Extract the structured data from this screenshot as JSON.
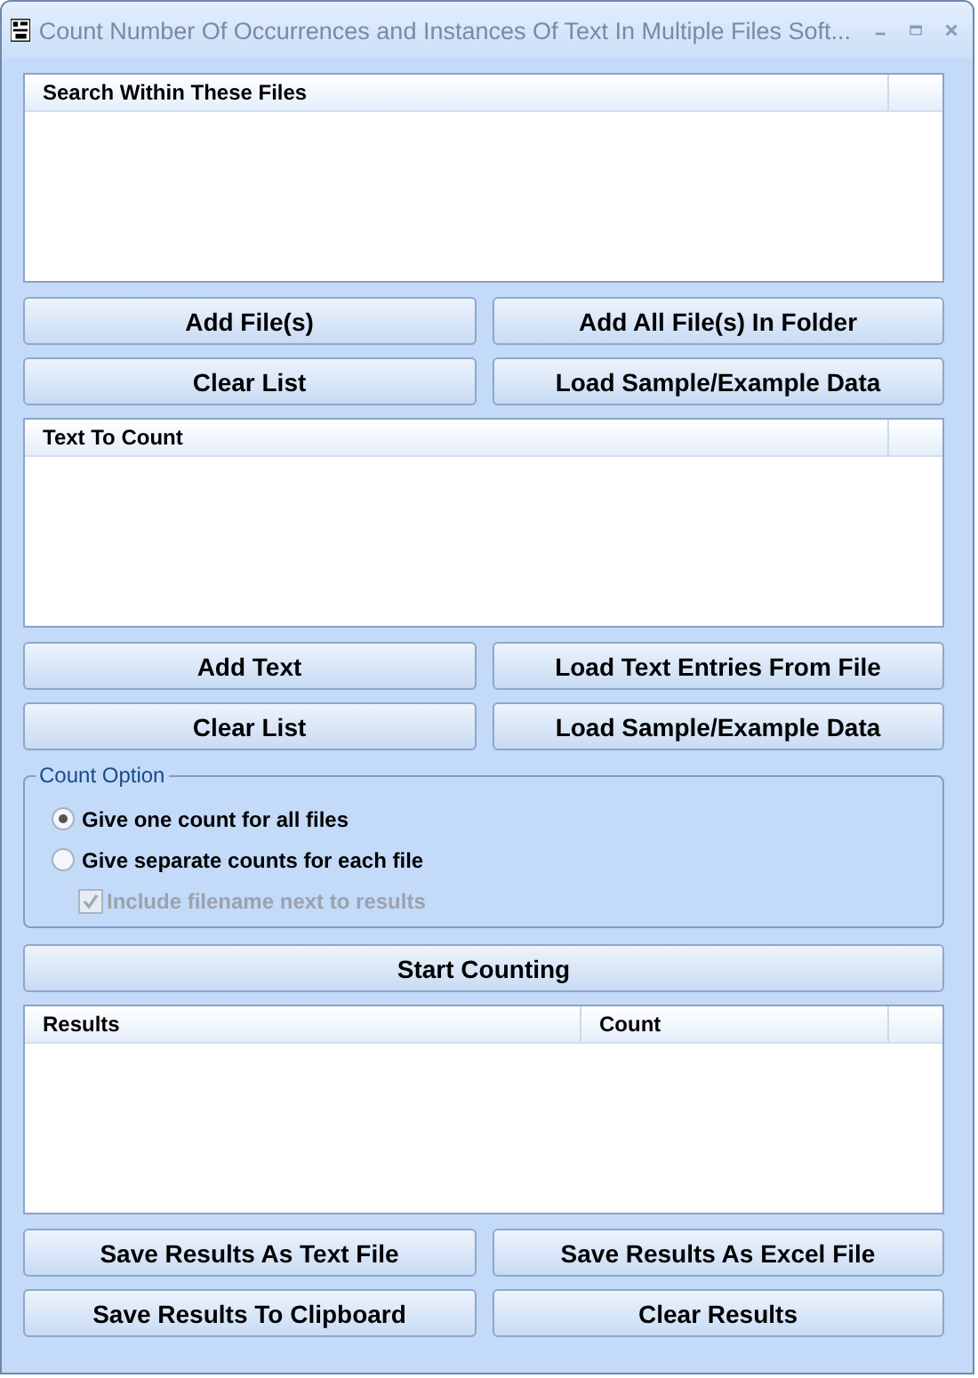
{
  "window": {
    "title": "Count Number Of Occurrences and Instances Of Text In Multiple Files Soft..."
  },
  "sections": [
    {
      "kind": "list",
      "columns": [
        "Search Within These Files"
      ]
    },
    {
      "kind": "buttons",
      "buttons": [
        "Add File(s)",
        "Add All File(s) In Folder"
      ]
    },
    {
      "kind": "buttons",
      "buttons": [
        "Clear List",
        "Load Sample/Example Data"
      ]
    },
    {
      "kind": "list",
      "columns": [
        "Text To Count"
      ]
    },
    {
      "kind": "buttons",
      "buttons": [
        "Add Text",
        "Load Text Entries From File"
      ]
    },
    {
      "kind": "buttons",
      "buttons": [
        "Clear List",
        "Load Sample/Example Data"
      ]
    },
    {
      "kind": "group",
      "title": "Count Option",
      "radios": [
        {
          "label": "Give one count for all files",
          "selected": true
        },
        {
          "label": "Give separate counts for each file",
          "selected": false
        }
      ],
      "checkbox": {
        "label": "Include filename next to results",
        "checked": true,
        "disabled": true
      }
    },
    {
      "kind": "buttons",
      "buttons": [
        "Start Counting"
      ]
    },
    {
      "kind": "list",
      "columns": [
        "Results",
        "Count"
      ]
    },
    {
      "kind": "buttons",
      "buttons": [
        "Save Results As Text File",
        "Save Results As Excel File"
      ]
    },
    {
      "kind": "buttons",
      "buttons": [
        "Save Results To Clipboard",
        "Clear Results"
      ]
    }
  ]
}
